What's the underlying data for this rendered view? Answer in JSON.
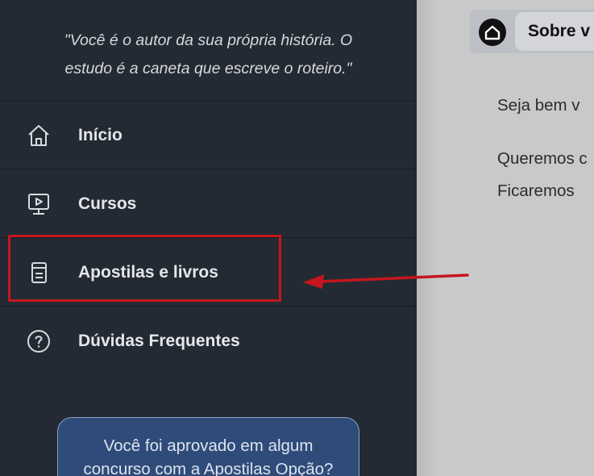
{
  "sidebar": {
    "quote_line1": "\"Você é o autor da sua própria história. O",
    "quote_line2": "estudo é a caneta que escreve o roteiro.\"",
    "items": [
      {
        "label": "Início",
        "icon": "home-icon"
      },
      {
        "label": "Cursos",
        "icon": "video-monitor-icon"
      },
      {
        "label": "Apostilas e livros",
        "icon": "book-icon"
      },
      {
        "label": "Dúvidas Frequentes",
        "icon": "question-circle-icon"
      }
    ],
    "cta_line1": "Você foi aprovado em algum",
    "cta_line2": "concurso com a Apostilas Opção?"
  },
  "main": {
    "header_label": "Sobre v",
    "para1": "Seja bem v",
    "para2_line1": "Queremos c",
    "para2_line2": "Ficaremos"
  },
  "annotation": {
    "highlight_color": "#c5161d"
  }
}
